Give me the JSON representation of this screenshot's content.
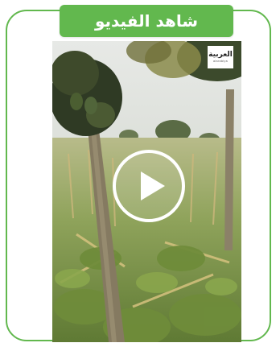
{
  "title": {
    "label": "شاهد الفيديو"
  },
  "video": {
    "logo_text_ar": "العربية",
    "logo_text_en": "alarabiya",
    "play_icon": "play-icon"
  },
  "colors": {
    "accent": "#62b84e",
    "background": "#ffffff"
  }
}
